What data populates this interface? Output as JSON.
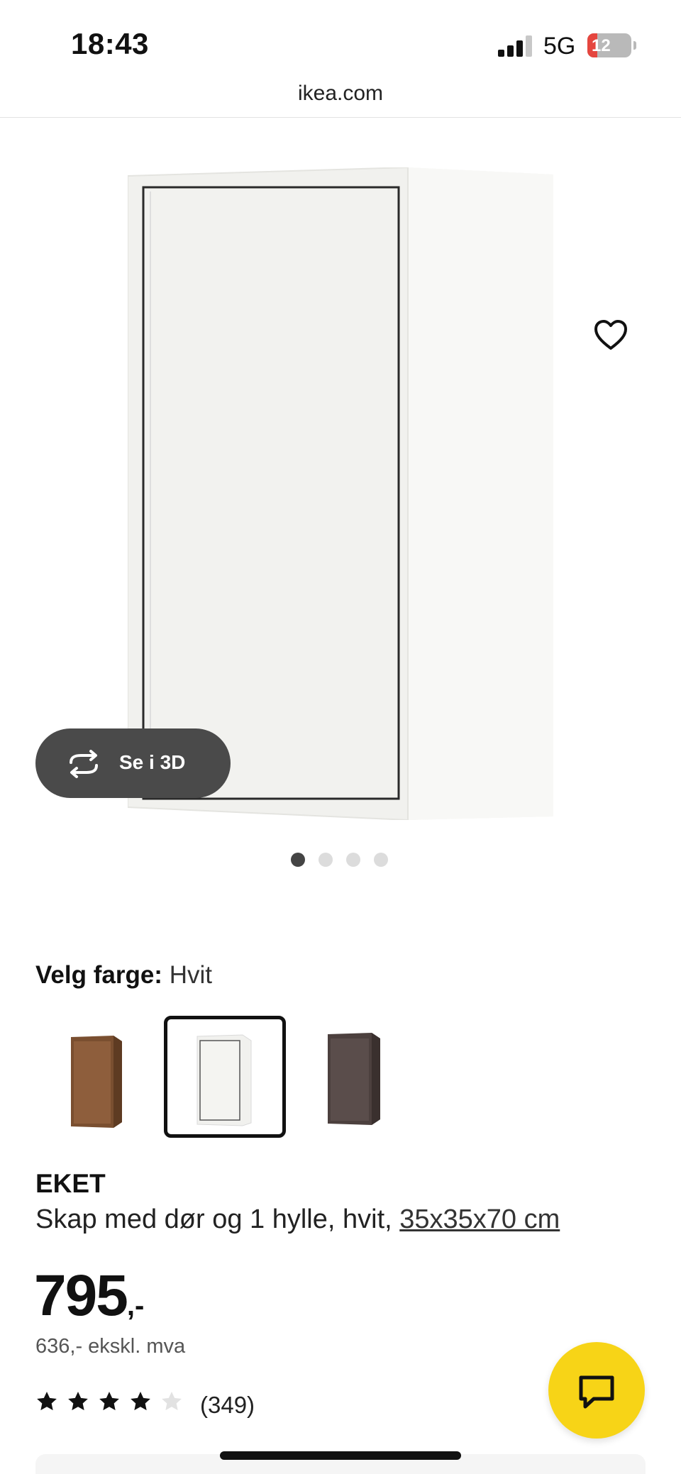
{
  "status_bar": {
    "time": "18:43",
    "network": "5G",
    "battery": "12",
    "battery_color": "#e5463f"
  },
  "browser": {
    "url": "ikea.com"
  },
  "gallery": {
    "view_3d_label": "Se i 3D",
    "image_count": 4,
    "active_image": 1
  },
  "color_picker": {
    "label": "Velg farge:",
    "selected": "Hvit",
    "options": [
      {
        "name": "walnut-swatch",
        "color": "#8a5c3a"
      },
      {
        "name": "white-swatch",
        "color": "#f4f4f1"
      },
      {
        "name": "dark-grey-swatch",
        "color": "#5a4d4b"
      }
    ]
  },
  "product": {
    "brand": "EKET",
    "description": "Skap med dør og 1 hylle, hvit,",
    "size": "35x35x70 cm",
    "price_int": "795",
    "price_suffix": ",-",
    "price_ex_vat": "636,- ekskl. mva",
    "rating": 4,
    "rating_max": 5,
    "review_count": "(349)"
  },
  "colors": {
    "accent": "#f7d417",
    "pill_bg": "#4a4a4a"
  }
}
